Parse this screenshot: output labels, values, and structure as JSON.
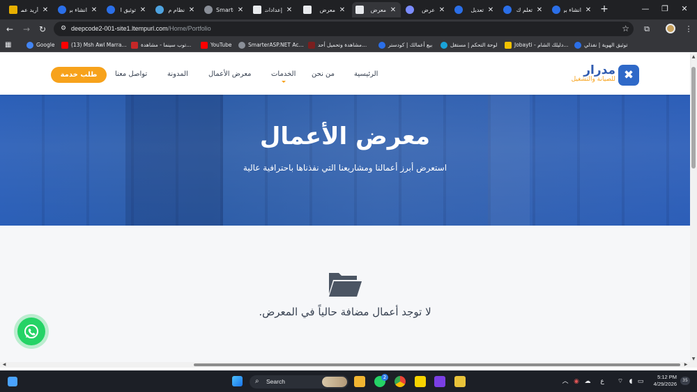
{
  "browser": {
    "tabs": [
      {
        "title": "أريد عمل",
        "favicon_color": "#e8b000"
      },
      {
        "title": "انشاء بر",
        "favicon_color": "#2b6fe8"
      },
      {
        "title": "توثيق ا",
        "favicon_color": "#2b6fe8"
      },
      {
        "title": "نظام م",
        "favicon_color": "#4ea3e0"
      },
      {
        "title": "Smarte",
        "favicon_color": "#8a8f98"
      },
      {
        "title": "إعدادات",
        "favicon_color": "#e8eaed"
      },
      {
        "title": "معرض",
        "favicon_color": "#e8eaed"
      },
      {
        "title": "معرض",
        "favicon_color": "#e8eaed"
      },
      {
        "title": "عرض",
        "favicon_color": "#7b8cff"
      },
      {
        "title": "تعديل",
        "favicon_color": "#2b6fe8"
      },
      {
        "title": "تعلم ك",
        "favicon_color": "#2b6fe8"
      },
      {
        "title": "انشاء بر",
        "favicon_color": "#2b6fe8"
      }
    ],
    "new_tab_label": "+",
    "url_host": "deepcode2-001-site1.ltempurl.com",
    "url_path": "/Home/Portfolio",
    "bookmarks": [
      {
        "label": "Google",
        "color": "#4285f4"
      },
      {
        "label": "(13) Msh Awl Marra...",
        "color": "#ff0000"
      },
      {
        "label": "توب سينما - مشاهدة...",
        "color": "#c62828"
      },
      {
        "label": "YouTube",
        "color": "#ff0000"
      },
      {
        "label": "SmarterASP.NET Ac...",
        "color": "#8a8f98"
      },
      {
        "label": "مشاهدة وتحميل أحد...",
        "color": "#7a1f1f"
      },
      {
        "label": "بيع أعمالك | كودستر",
        "color": "#2b6fe8"
      },
      {
        "label": "لوحة التحكم | مستقل",
        "color": "#1aa3d9"
      },
      {
        "label": "Jobayti - دليلك الشام...",
        "color": "#f2c200"
      },
      {
        "label": "توثيق الهوية | نفذلي",
        "color": "#2b6fe8"
      }
    ]
  },
  "site": {
    "logo": {
      "name": "مدرار",
      "tagline": "للصيانة والتشغيل"
    },
    "nav": {
      "home": "الرئيسية",
      "about": "من نحن",
      "services": "الخدمات",
      "portfolio": "معرض الأعمال",
      "blog": "المدونة",
      "contact": "تواصل معنا"
    },
    "cta": "طلب خدمة",
    "hero": {
      "title": "معرض الأعمال",
      "subtitle": "استعرض أبرز أعمالنا ومشاريعنا التي نفذناها باحترافية عالية"
    },
    "empty_state": "لا توجد أعمال مضافة حالياً في المعرض.",
    "colors": {
      "primary": "#2f69c8",
      "accent": "#f7a21b",
      "whatsapp": "#25d366"
    }
  },
  "taskbar": {
    "search_label": "Search",
    "whatsapp_badge": "2",
    "lang": "ع",
    "time": "5:12 PM",
    "date": "4/29/2026",
    "notif": "35"
  }
}
